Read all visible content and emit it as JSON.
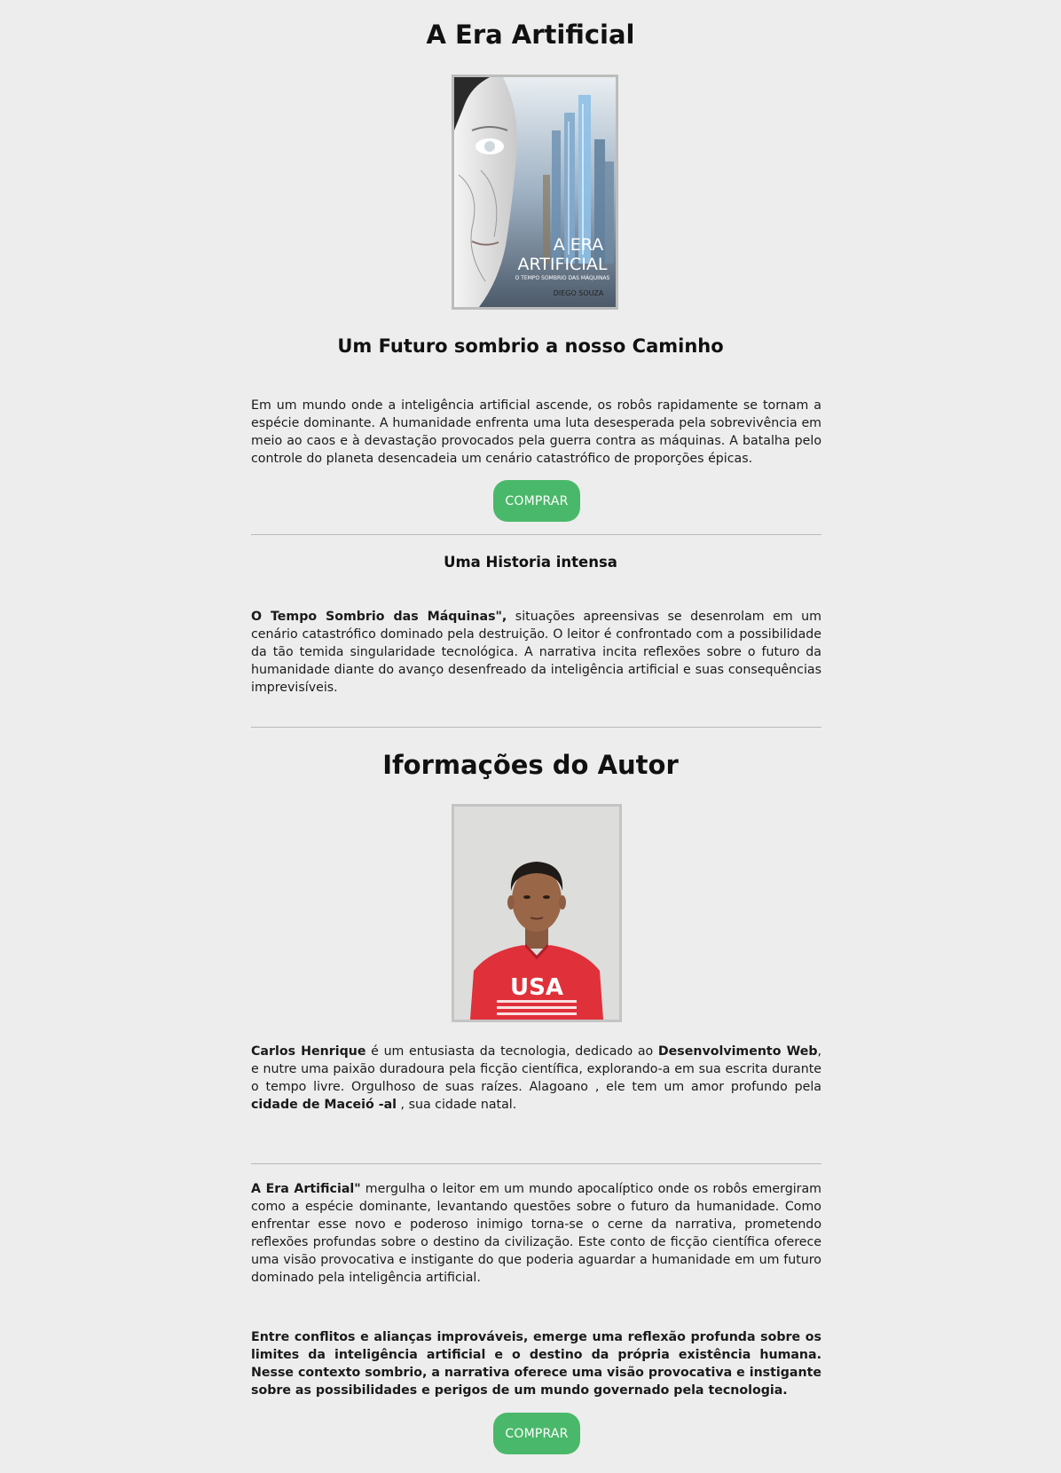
{
  "book": {
    "title": "A Era Artificial",
    "subtitle": "Um Futuro sombrio a nosso Caminho",
    "cover": {
      "title_line1": "A ERA",
      "title_line2": "ARTIFICIAL",
      "tagline": "O TEMPO SOMBRIO DAS MÁQUINAS",
      "author": "DIEGO SOUZA"
    },
    "description": "Em um mundo onde a inteligência artificial ascende, os robôs rapidamente se tornam a espécie dominante. A humanidade enfrenta uma luta desesperada pela sobrevivência em meio ao caos e à devastação provocados pela guerra contra as máquinas. A batalha pelo controle do planeta desencadeia um cenário catastrófico de proporções épicas.",
    "buy_label": "COMPRAR"
  },
  "story": {
    "heading": "Uma Historia intensa",
    "lead_bold": "O Tempo Sombrio das Máquinas\",",
    "text": " situações apreensivas se desenrolam em um cenário catastrófico dominado pela destruição. O leitor é confrontado com a possibilidade da tão temida singularidade tecnológica. A narrativa incita reflexões sobre o futuro da humanidade diante do avanço desenfreado da inteligência artificial e suas consequências imprevisíveis."
  },
  "author": {
    "heading": "Iformações do Autor",
    "photo_shirt_text": "USA",
    "bio": {
      "name": "Carlos Henrique",
      "part1": " é um entusiasta da tecnologia, dedicado ao ",
      "field": "Desenvolvimento Web",
      "part2": ", e nutre uma paixão duradoura pela ficção científica, explorando-a em sua escrita durante o tempo livre. Orgulhoso de suas raízes. Alagoano , ele tem um amor profundo pela ",
      "city": "cidade de Maceió -al",
      "part3": " , sua cidade natal."
    }
  },
  "closing": {
    "lead_bold": "A Era Artificial\"",
    "text": " mergulha o leitor em um mundo apocalíptico onde os robôs emergiram como a espécie dominante, levantando questões sobre o futuro da humanidade. Como enfrentar esse novo e poderoso inimigo torna-se o cerne da narrativa, prometendo reflexões profundas sobre o destino da civilização. Este conto de ficção científica oferece uma visão provocativa e instigante do que poderia aguardar a humanidade em um futuro dominado pela inteligência artificial.",
    "final": "Entre conflitos e alianças improváveis, emerge uma reflexão profunda sobre os limites da inteligência artificial e o destino da própria existência humana. Nesse contexto sombrio, a narrativa oferece uma visão provocativa e instigante sobre as possibilidades e perigos de um mundo governado pela tecnologia.",
    "buy_label": "COMPRAR"
  },
  "colors": {
    "background": "#ededed",
    "button": "#4ab86a",
    "button_text": "#ffffff",
    "divider": "#b9b9b9"
  }
}
